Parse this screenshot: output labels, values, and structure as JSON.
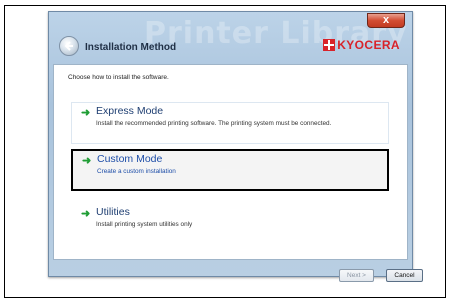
{
  "window": {
    "title": "Installation Method",
    "watermark": "Printer Library",
    "close_label": "x",
    "brand": "KYOCERA"
  },
  "prompt": "Choose how to install the software.",
  "options": [
    {
      "title": "Express Mode",
      "description": "Install the recommended printing software. The printing system must be connected."
    },
    {
      "title": "Custom Mode",
      "description": "Create a custom installation"
    },
    {
      "title": "Utilities",
      "description": "Install printing system utilities only"
    }
  ],
  "buttons": {
    "next": "Next >",
    "cancel": "Cancel"
  },
  "colors": {
    "brand_red": "#d8232a",
    "arrow_green": "#1f9d34",
    "link_blue": "#1e4ea8"
  }
}
